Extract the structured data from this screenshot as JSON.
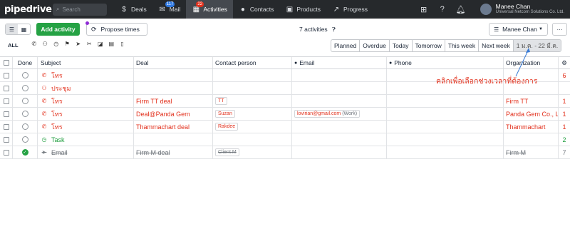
{
  "topbar": {
    "logo": "pipedrive",
    "search_placeholder": "Search",
    "nav": [
      {
        "label": "Deals",
        "icon": "dollar-icon",
        "badge": ""
      },
      {
        "label": "Mail",
        "icon": "mail-icon",
        "badge": "117"
      },
      {
        "label": "Activities",
        "icon": "calendar-icon",
        "badge": "22",
        "active": true
      },
      {
        "label": "Contacts",
        "icon": "person-icon",
        "badge": ""
      },
      {
        "label": "Products",
        "icon": "box-icon",
        "badge": ""
      },
      {
        "label": "Progress",
        "icon": "trend-icon",
        "badge": ""
      }
    ],
    "user_name": "Manee Chan",
    "user_org": "Universal Netcom Solutions Co. Ltd."
  },
  "toolbar": {
    "add_label": "Add activity",
    "propose_label": "Propose times",
    "count_label": "7 activities",
    "user_filter": "Manee Chan",
    "more_label": "···"
  },
  "filters": {
    "all_label": "ALL",
    "type_icons": [
      "phone-icon",
      "meeting-icon",
      "clock-icon",
      "flag-icon",
      "send-icon",
      "lunch-icon",
      "deadline-icon",
      "note-icon",
      "mobile-icon"
    ],
    "periods": [
      "Planned",
      "Overdue",
      "Today",
      "Tomorrow",
      "This week",
      "Next week",
      "1 ม.ค. - 22 มี.ค."
    ],
    "selected_period": "1 ม.ค. - 22 มี.ค."
  },
  "table": {
    "headers": {
      "done": "Done",
      "subject": "Subject",
      "deal": "Deal",
      "contact": "Contact person",
      "email": "Email",
      "phone": "Phone",
      "org": "Organization"
    },
    "rows": [
      {
        "subject": "โทร",
        "type": "phone",
        "deal": "",
        "contact": "",
        "email": "",
        "email_tag": "",
        "org": "",
        "overflow": "6",
        "color": "red",
        "done": false
      },
      {
        "subject": "ประชุม",
        "type": "meeting",
        "deal": "",
        "contact": "",
        "email": "",
        "email_tag": "",
        "org": "",
        "overflow": "",
        "color": "red",
        "done": false
      },
      {
        "subject": "โทร",
        "type": "phone",
        "deal": "Firm TT deal",
        "contact": "TT",
        "email": "",
        "email_tag": "",
        "org": "Firm TT",
        "overflow": "1",
        "color": "red",
        "done": false
      },
      {
        "subject": "โทร",
        "type": "phone",
        "deal": "Deal@Panda Gem",
        "contact": "Suzan",
        "email": "lovirian@gmail.com",
        "email_tag": "(Work)",
        "org": "Panda Gem Co., Ltd.",
        "overflow": "1",
        "color": "red",
        "done": false
      },
      {
        "subject": "โทร",
        "type": "phone",
        "deal": "Thammachart deal",
        "contact": "Rakdee",
        "email": "",
        "email_tag": "",
        "org": "Thammachart",
        "overflow": "1",
        "color": "red",
        "done": false
      },
      {
        "subject": "Task",
        "type": "task",
        "deal": "",
        "contact": "",
        "email": "",
        "email_tag": "",
        "org": "",
        "overflow": "2",
        "color": "green",
        "done": false
      },
      {
        "subject": "Email",
        "type": "email",
        "deal": "Firm M deal",
        "contact": "Client M",
        "email": "",
        "email_tag": "",
        "org": "Firm M",
        "overflow": "7",
        "color": "gray",
        "done": true
      }
    ]
  },
  "annotation": "คลิกเพื่อเลือกช่วงเวลาที่ต้องการ",
  "colors": {
    "accent_green": "#25a244",
    "overdue_red": "#e2311d",
    "topbar": "#26292c"
  }
}
